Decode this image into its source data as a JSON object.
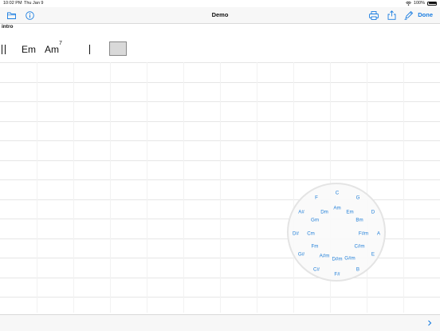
{
  "status_bar": {
    "time": "10:02 PM",
    "date": "Thu Jan 9",
    "battery": "100%"
  },
  "toolbar": {
    "title": "Demo",
    "done_label": "Done"
  },
  "section": {
    "label": "intro"
  },
  "chords": {
    "chord1": "Em",
    "chord2_root": "Am",
    "chord2_ext": "7"
  },
  "chord_wheel": {
    "chords": [
      "C",
      "G",
      "D",
      "A",
      "E",
      "B",
      "F#",
      "C#",
      "G#",
      "D#",
      "A#",
      "F",
      "Am",
      "Em",
      "Bm",
      "F#m",
      "C#m",
      "G#m",
      "D#m",
      "A#m",
      "Fm",
      "Cm",
      "Gm",
      "Dm"
    ]
  },
  "colors": {
    "accent": "#1a7de0",
    "wheel_text": "#1f7ed8"
  },
  "icons": [
    "folder-icon",
    "info-icon",
    "print-icon",
    "share-icon",
    "pen-icon",
    "chevron-right-icon",
    "wifi-icon",
    "battery-icon"
  ]
}
